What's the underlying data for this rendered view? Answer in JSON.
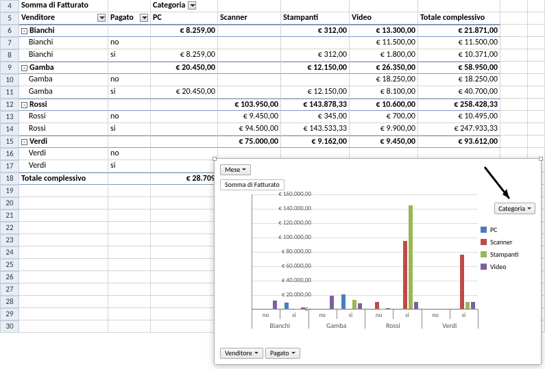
{
  "header": {
    "measure_label": "Somma di Fatturato",
    "col_field": "Categoria",
    "row_field1": "Venditore",
    "row_field2": "Pagato",
    "cols": [
      "PC",
      "Scanner",
      "Stampanti",
      "Video",
      "Totale complessivo"
    ]
  },
  "rows": [
    {
      "n": 6,
      "kind": "group",
      "name": "Bianchi",
      "vals": [
        "€      8.259,00",
        "",
        "€          312,00",
        "€    13.300,00",
        "€             21.871,00"
      ]
    },
    {
      "n": 7,
      "kind": "leaf",
      "name": "Bianchi",
      "p": "no",
      "vals": [
        "",
        "",
        "",
        "€    11.500,00",
        "€             11.500,00"
      ]
    },
    {
      "n": 8,
      "kind": "leaf",
      "name": "Bianchi",
      "p": "si",
      "vals": [
        "€      8.259,00",
        "",
        "€          312,00",
        "€      1.800,00",
        "€             10.371,00"
      ]
    },
    {
      "n": 9,
      "kind": "group",
      "name": "Gamba",
      "vals": [
        "€    20.450,00",
        "",
        "€    12.150,00",
        "€    26.350,00",
        "€             58.950,00"
      ]
    },
    {
      "n": 10,
      "kind": "leaf",
      "name": "Gamba",
      "p": "no",
      "vals": [
        "",
        "",
        "",
        "€    18.250,00",
        "€             18.250,00"
      ]
    },
    {
      "n": 11,
      "kind": "leaf",
      "name": "Gamba",
      "p": "si",
      "vals": [
        "€    20.450,00",
        "",
        "€    12.150,00",
        "€      8.100,00",
        "€             40.700,00"
      ]
    },
    {
      "n": 12,
      "kind": "group",
      "name": "Rossi",
      "vals": [
        "",
        "€  103.950,00",
        "€  143.878,33",
        "€    10.600,00",
        "€          258.428,33"
      ]
    },
    {
      "n": 13,
      "kind": "leaf",
      "name": "Rossi",
      "p": "no",
      "vals": [
        "",
        "€      9.450,00",
        "€          345,00",
        "€          700,00",
        "€             10.495,00"
      ]
    },
    {
      "n": 14,
      "kind": "leaf",
      "name": "Rossi",
      "p": "si",
      "vals": [
        "",
        "€    94.500,00",
        "€  143.533,33",
        "€      9.900,00",
        "€          247.933,33"
      ]
    },
    {
      "n": 15,
      "kind": "group",
      "name": "Verdi",
      "vals": [
        "",
        "€    75.000,00",
        "€      9.162,00",
        "€      9.450,00",
        "€             93.612,00"
      ]
    },
    {
      "n": 16,
      "kind": "leaf",
      "name": "Verdi",
      "p": "no",
      "vals": [
        "",
        "",
        "",
        "",
        ""
      ]
    },
    {
      "n": 17,
      "kind": "leaf",
      "name": "Verdi",
      "p": "si",
      "vals": [
        "",
        "",
        "",
        "",
        ""
      ]
    }
  ],
  "grand_total": {
    "n": 18,
    "label": "Totale complessivo",
    "vals": [
      "€    28.709",
      "",
      "",
      "",
      ""
    ]
  },
  "empty_rows": [
    19,
    20,
    21,
    22,
    23,
    24,
    25,
    26,
    27,
    28,
    29,
    30
  ],
  "chart": {
    "btn_mese": "Mese",
    "title": "Somma di Fatturato",
    "btn_venditore": "Venditore",
    "btn_pagato": "Pagato",
    "btn_categoria": "Categoria",
    "legend": [
      "PC",
      "Scanner",
      "Stampanti",
      "Video"
    ],
    "ylabels": [
      "€ 160.000,00",
      "€ 140.000,00",
      "€ 120.000,00",
      "€ 100.000,00",
      "€ 80.000,00",
      "€ 60.000,00",
      "€ 40.000,00",
      "€ 20.000,00",
      "€ -"
    ],
    "x_sub": [
      "no",
      "si",
      "no",
      "si",
      "no",
      "si",
      "no",
      "si"
    ],
    "x_sup": [
      "Bianchi",
      "Gamba",
      "Rossi",
      "Verdi"
    ]
  },
  "chart_data": {
    "type": "bar",
    "ylim": [
      0,
      160000
    ],
    "categories_level1": [
      "Bianchi",
      "Gamba",
      "Rossi",
      "Verdi"
    ],
    "categories_level2": [
      "no",
      "si"
    ],
    "series": [
      {
        "name": "PC",
        "values": [
          0,
          8259,
          0,
          20450,
          0,
          0,
          0,
          0
        ]
      },
      {
        "name": "Scanner",
        "values": [
          0,
          0,
          0,
          0,
          9450,
          94500,
          0,
          75000
        ]
      },
      {
        "name": "Stampanti",
        "values": [
          0,
          312,
          0,
          12150,
          345,
          143533,
          0,
          9162
        ]
      },
      {
        "name": "Video",
        "values": [
          11500,
          1800,
          18250,
          8100,
          700,
          9900,
          0,
          9450
        ]
      }
    ],
    "title": "Somma di Fatturato",
    "ylabel": "",
    "xlabel": ""
  }
}
